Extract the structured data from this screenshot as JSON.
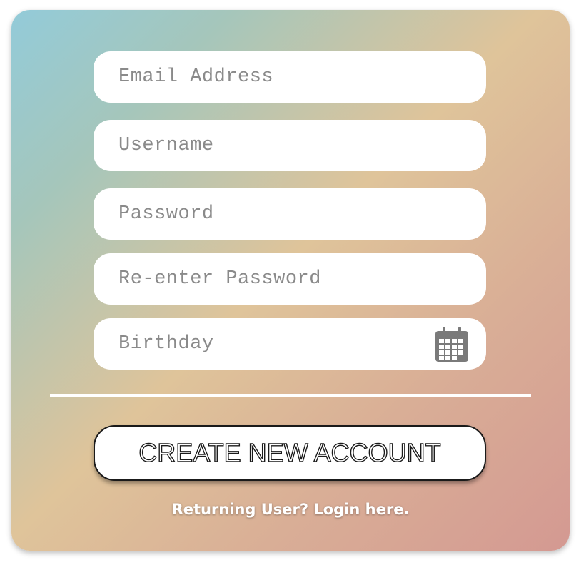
{
  "form": {
    "email": {
      "value": "",
      "placeholder": "Email Address"
    },
    "username": {
      "value": "",
      "placeholder": "Username"
    },
    "password": {
      "value": "",
      "placeholder": "Password"
    },
    "reenter_password": {
      "value": "",
      "placeholder": "Re-enter Password"
    },
    "birthday": {
      "value": "",
      "placeholder": "Birthday",
      "icon": "calendar-icon"
    }
  },
  "actions": {
    "create_label": "CREATE NEW ACCOUNT",
    "login_link_label": "Returning User? Login here."
  },
  "colors": {
    "gradient_start": "#93cbd9",
    "gradient_mid": "#dfc49a",
    "gradient_end": "#d49992",
    "field_background": "#ffffff",
    "placeholder_text": "#8a8a8a",
    "icon": "#7a7a7a"
  }
}
